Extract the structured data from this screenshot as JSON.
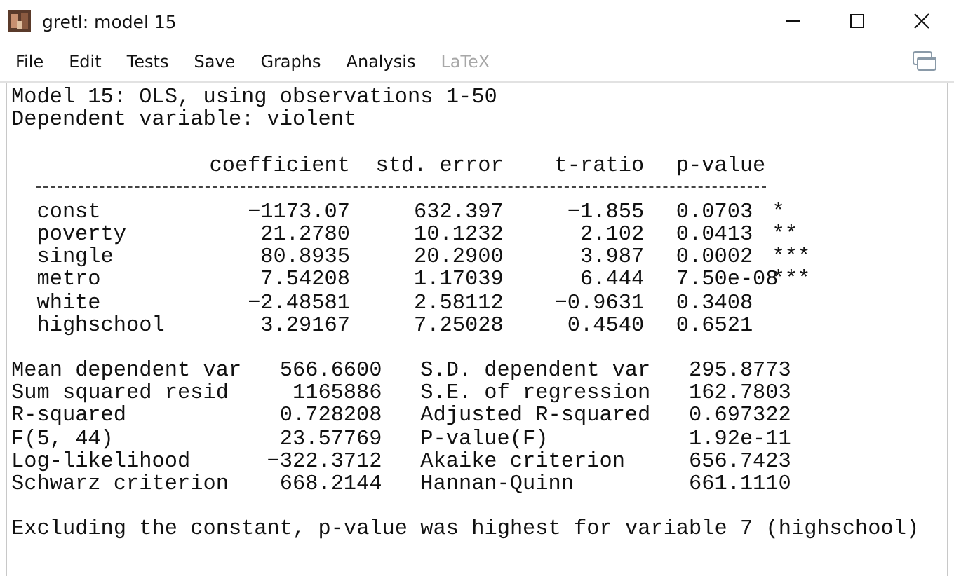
{
  "window": {
    "title": "gretl: model 15"
  },
  "menu": [
    {
      "label": "File",
      "disabled": false
    },
    {
      "label": "Edit",
      "disabled": false
    },
    {
      "label": "Tests",
      "disabled": false
    },
    {
      "label": "Save",
      "disabled": false
    },
    {
      "label": "Graphs",
      "disabled": false
    },
    {
      "label": "Analysis",
      "disabled": false
    },
    {
      "label": "LaTeX",
      "disabled": true
    }
  ],
  "output": {
    "header_lines": [
      "Model 15: OLS, using observations 1-50",
      "Dependent variable: violent"
    ],
    "table": {
      "columns": [
        "coefficient",
        "std. error",
        "t-ratio",
        "p-value"
      ],
      "rows": [
        {
          "name": "const",
          "coefficient": "−1173.07",
          "std_error": "632.397",
          "t_ratio": "−1.855",
          "p_value": "0.0703",
          "significance": "*"
        },
        {
          "name": "poverty",
          "coefficient": "21.2780",
          "std_error": "10.1232",
          "t_ratio": "2.102",
          "p_value": "0.0413",
          "significance": "**"
        },
        {
          "name": "single",
          "coefficient": "80.8935",
          "std_error": "20.2900",
          "t_ratio": "3.987",
          "p_value": "0.0002",
          "significance": "***"
        },
        {
          "name": "metro",
          "coefficient": "7.54208",
          "std_error": "1.17039",
          "t_ratio": "6.444",
          "p_value": "7.50e-08",
          "significance": "***"
        },
        {
          "name": "white",
          "coefficient": "−2.48581",
          "std_error": "2.58112",
          "t_ratio": "−0.9631",
          "p_value": "0.3408",
          "significance": ""
        },
        {
          "name": "highschool",
          "coefficient": "3.29167",
          "std_error": "7.25028",
          "t_ratio": "0.4540",
          "p_value": "0.6521",
          "significance": ""
        }
      ]
    },
    "stats": [
      {
        "label_1": "Mean dependent var",
        "value_1": "566.6600",
        "label_2": "S.D. dependent var",
        "value_2": "295.8773"
      },
      {
        "label_1": "Sum squared resid",
        "value_1": "1165886",
        "label_2": "S.E. of regression",
        "value_2": "162.7803"
      },
      {
        "label_1": "R-squared",
        "value_1": "0.728208",
        "label_2": "Adjusted R-squared",
        "value_2": "0.697322"
      },
      {
        "label_1": "F(5, 44)",
        "value_1": "23.57769",
        "label_2": "P-value(F)",
        "value_2": "1.92e-11"
      },
      {
        "label_1": "Log-likelihood",
        "value_1": "−322.3712",
        "label_2": "Akaike criterion",
        "value_2": "656.7423"
      },
      {
        "label_1": "Schwarz criterion",
        "value_1": "668.2144",
        "label_2": "Hannan-Quinn",
        "value_2": "661.1110"
      }
    ],
    "note": "Excluding the constant, p-value was highest for variable 7 (highschool)"
  }
}
